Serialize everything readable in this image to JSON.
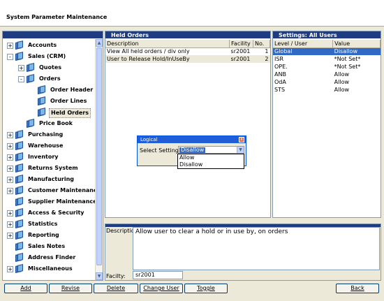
{
  "window": {
    "title": "System Parameter Maintenance"
  },
  "tree": {
    "items": [
      {
        "label": "Accounts",
        "toggle": "+"
      },
      {
        "label": "Sales (CRM)",
        "toggle": "-"
      },
      {
        "label": "Quotes",
        "toggle": "+"
      },
      {
        "label": "Orders",
        "toggle": "-"
      },
      {
        "label": "Order Header",
        "toggle": ""
      },
      {
        "label": "Order Lines",
        "toggle": ""
      },
      {
        "label": "Held Orders",
        "toggle": ""
      },
      {
        "label": "Price Book",
        "toggle": ""
      },
      {
        "label": "Purchasing",
        "toggle": "+"
      },
      {
        "label": "Warehouse",
        "toggle": "+"
      },
      {
        "label": "Inventory",
        "toggle": "+"
      },
      {
        "label": "Returns System",
        "toggle": "+"
      },
      {
        "label": "Manufacturing",
        "toggle": "+"
      },
      {
        "label": "Customer Maintenance",
        "toggle": "+"
      },
      {
        "label": "Supplier Maintenance",
        "toggle": ""
      },
      {
        "label": "Access & Security",
        "toggle": "+"
      },
      {
        "label": "Statistics",
        "toggle": "+"
      },
      {
        "label": "Reporting",
        "toggle": "+"
      },
      {
        "label": "Sales Notes",
        "toggle": ""
      },
      {
        "label": "Address Finder",
        "toggle": ""
      },
      {
        "label": "Miscellaneous",
        "toggle": "+"
      }
    ],
    "selected": "Held Orders"
  },
  "held_orders": {
    "title": "Held Orders",
    "columns": [
      "Description",
      "Facility",
      "No."
    ],
    "rows": [
      [
        "View All held orders / div only",
        "sr2001",
        "1"
      ],
      [
        "User to Release Hold/InUseBy",
        "sr2001",
        "2"
      ]
    ]
  },
  "settings": {
    "title": "Settings: All Users",
    "columns": [
      "Level / User",
      "Value"
    ],
    "rows": [
      [
        "Global",
        "Disallow"
      ],
      [
        "ISR",
        "*Not Set*"
      ],
      [
        "OPE.",
        "*Not Set*"
      ],
      [
        "ANB",
        "Allow"
      ],
      [
        "OdA",
        "Allow"
      ],
      [
        "STS",
        "Allow"
      ]
    ]
  },
  "detail": {
    "description_label": "Description:",
    "description_value": "Allow user to clear a hold or in use by, on orders",
    "facility_label": "Facilty:",
    "facility_value": "sr2001"
  },
  "dialog": {
    "title": "Logical",
    "close_symbol": "x",
    "select_label": "Select Setting:",
    "selected_value": "Disallow",
    "options": [
      "Allow",
      "Disallow"
    ]
  },
  "buttons": {
    "add": "Add",
    "revise": "Revise",
    "delete": "Delete",
    "change_user": "Change User",
    "toggle": "Toggle",
    "back": "Back"
  },
  "colors": {
    "panel_header": "#1f3b82",
    "selection": "#316ac5",
    "window_bg": "#ece9d8"
  }
}
